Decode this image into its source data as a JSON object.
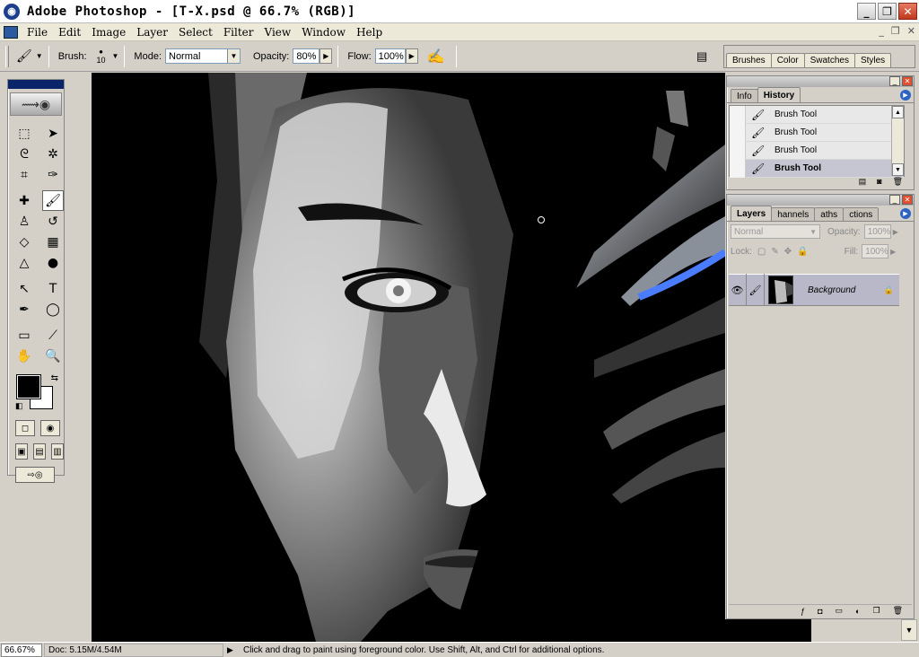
{
  "window": {
    "title": "Adobe Photoshop - [T-X.psd @ 66.7% (RGB)]",
    "app_icon": "photoshop-eye-icon"
  },
  "menu": [
    "File",
    "Edit",
    "Image",
    "Layer",
    "Select",
    "Filter",
    "View",
    "Window",
    "Help"
  ],
  "options": {
    "brush_label": "Brush:",
    "brush_size": "10",
    "mode_label": "Mode:",
    "mode_value": "Normal",
    "opacity_label": "Opacity:",
    "opacity_value": "80%",
    "flow_label": "Flow:",
    "flow_value": "100%"
  },
  "palette_well": {
    "tabs": [
      "Brushes",
      "Color",
      "Swatches",
      "Styles"
    ]
  },
  "history": {
    "tabs": [
      "Info",
      "History"
    ],
    "active_tab": "History",
    "items": [
      "Brush Tool",
      "Brush Tool",
      "Brush Tool",
      "Brush Tool"
    ]
  },
  "layers": {
    "tabs": [
      "Layers",
      "Channels",
      "Paths",
      "Actions"
    ],
    "tab_labels_visible": [
      "Layers",
      "hannels",
      "aths",
      "ctions"
    ],
    "active_tab": "Layers",
    "blend_mode": "Normal",
    "opacity_label": "Opacity:",
    "opacity_value": "100%",
    "lock_label": "Lock:",
    "fill_label": "Fill:",
    "fill_value": "100%",
    "layer_name": "Background"
  },
  "status": {
    "zoom": "66.67%",
    "doc": "Doc: 5.15M/4.54M",
    "hint": "Click and drag to paint using foreground color.  Use Shift, Alt, and Ctrl for additional options."
  },
  "colors": {
    "foreground": "#000000",
    "background": "#ffffff",
    "accent_blue": "#2d64c4"
  }
}
